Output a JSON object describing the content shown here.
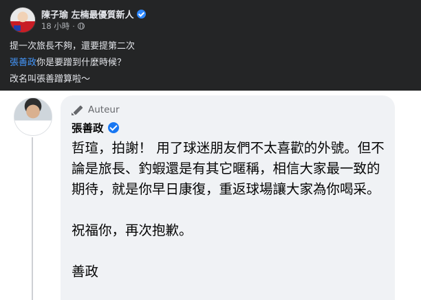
{
  "post": {
    "author": "陳子瑜 左楠最優質新人",
    "time": "18 小時",
    "line1": "提一次旅長不夠，還要提第二次",
    "line2_mention": "張善政",
    "line2_rest": "你是要蹭到什麼時候？",
    "line3": "改名叫張善蹭算啦～"
  },
  "comment": {
    "badge": "Auteur",
    "author": "張善政",
    "paragraph1": "哲瑄，拍謝！ 用了球迷朋友們不太喜歡的外號。但不論是旅長、釣蝦還是有其它暱稱，相信大家最一致的期待，就是你早日康復，重返球場讓大家為你喝采。",
    "paragraph2": "祝福你，再次抱歉。",
    "signature": "善政"
  },
  "colors": {
    "post_bg": "#242526",
    "mention": "#4599ff",
    "bubble_bg": "#f0f2f5",
    "verified": "#1877f2"
  },
  "icons": [
    "verified-badge-icon",
    "globe-icon",
    "pen-icon"
  ]
}
